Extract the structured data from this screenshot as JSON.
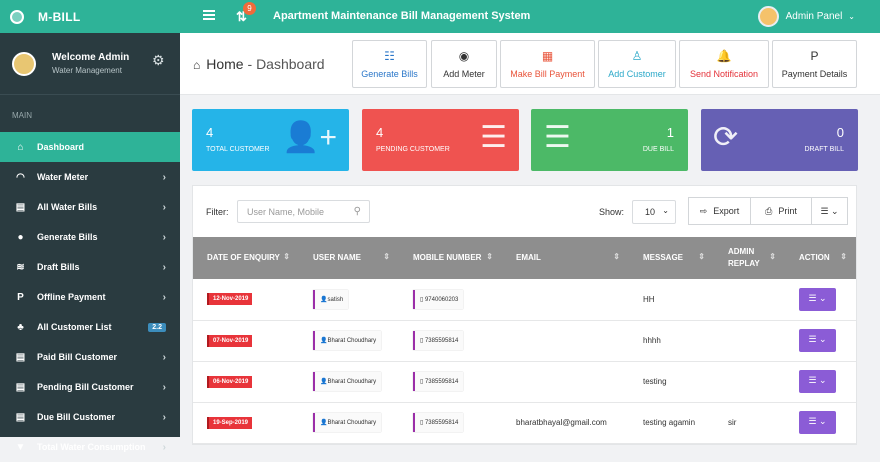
{
  "app": {
    "brand": "M-BILL",
    "title": "Apartment Maintenance Bill Management System",
    "notif_count": "9",
    "admin_label": "Admin Panel"
  },
  "profile": {
    "name": "Welcome Admin",
    "sub": "Water Management"
  },
  "sidebar": {
    "section": "MAIN",
    "items": [
      {
        "label": "Dashboard",
        "icon": "home-icon",
        "glyph": "⌂"
      },
      {
        "label": "Water Meter",
        "icon": "gauge-icon",
        "glyph": "◠"
      },
      {
        "label": "All Water Bills",
        "icon": "bill-icon",
        "glyph": "▤"
      },
      {
        "label": "Generate Bills",
        "icon": "drop-icon",
        "glyph": "●"
      },
      {
        "label": "Draft Bills",
        "icon": "layers-icon",
        "glyph": "≋"
      },
      {
        "label": "Offline Payment",
        "icon": "paypal-icon",
        "glyph": "P"
      },
      {
        "label": "All Customer List",
        "icon": "users-icon",
        "glyph": "♣",
        "count": "2.2"
      },
      {
        "label": "Paid Bill Customer",
        "icon": "doc-icon",
        "glyph": "▤"
      },
      {
        "label": "Pending Bill Customer",
        "icon": "doc-icon",
        "glyph": "▤"
      },
      {
        "label": "Due Bill Customer",
        "icon": "doc-icon",
        "glyph": "▤"
      },
      {
        "label": "Total Water Consumption",
        "icon": "filter-icon",
        "glyph": "▼"
      }
    ]
  },
  "header": {
    "home": "Home",
    "sep": " - ",
    "page": "Dashboard"
  },
  "toolbar": [
    {
      "label": "Generate Bills",
      "color": "#2b77c9",
      "glyph": "☷"
    },
    {
      "label": "Add Meter",
      "color": "#333333",
      "glyph": "◉"
    },
    {
      "label": "Make Bill Payment",
      "color": "#e8543a",
      "glyph": "▦"
    },
    {
      "label": "Add Customer",
      "color": "#2aa8c8",
      "glyph": "♙"
    },
    {
      "label": "Send Notification",
      "color": "#e4323a",
      "glyph": "🔔"
    },
    {
      "label": "Payment Details",
      "color": "#333333",
      "glyph": "P"
    }
  ],
  "cards": [
    {
      "num": "4",
      "label": "TOTAL CUSTOMER",
      "color": "#25b4e8"
    },
    {
      "num": "4",
      "label": "PENDING CUSTOMER",
      "color": "#ef5350"
    },
    {
      "num": "1",
      "label": "DUE BILL",
      "color": "#4cb967"
    },
    {
      "num": "0",
      "label": "DRAFT BILL",
      "color": "#6660b4"
    }
  ],
  "filter": {
    "label": "Filter:",
    "placeholder": "User Name, Mobile",
    "show_label": "Show:",
    "show_value": "10",
    "export": "Export",
    "print": "Print"
  },
  "table": {
    "headers": [
      "DATE OF ENQUIRY",
      "USER NAME",
      "MOBILE NUMBER",
      "EMAIL",
      "MESSAGE",
      "ADMIN REPLAY",
      "ACTION"
    ],
    "rows": [
      {
        "date": "12-Nov-2019",
        "user": "satish",
        "mobile": "9740060203",
        "email": "",
        "message": "HH",
        "reply": ""
      },
      {
        "date": "07-Nov-2019",
        "user": "Bharat Choudhary",
        "mobile": "7385595814",
        "email": "",
        "message": "hhhh",
        "reply": ""
      },
      {
        "date": "06-Nov-2019",
        "user": "Bharat Choudhary",
        "mobile": "7385595814",
        "email": "",
        "message": "testing",
        "reply": ""
      },
      {
        "date": "19-Sep-2019",
        "user": "Bharat Choudhary",
        "mobile": "7385595814",
        "email": "bharatbhayal@gmail.com",
        "message": "testing agamin",
        "reply": "sir"
      }
    ]
  }
}
